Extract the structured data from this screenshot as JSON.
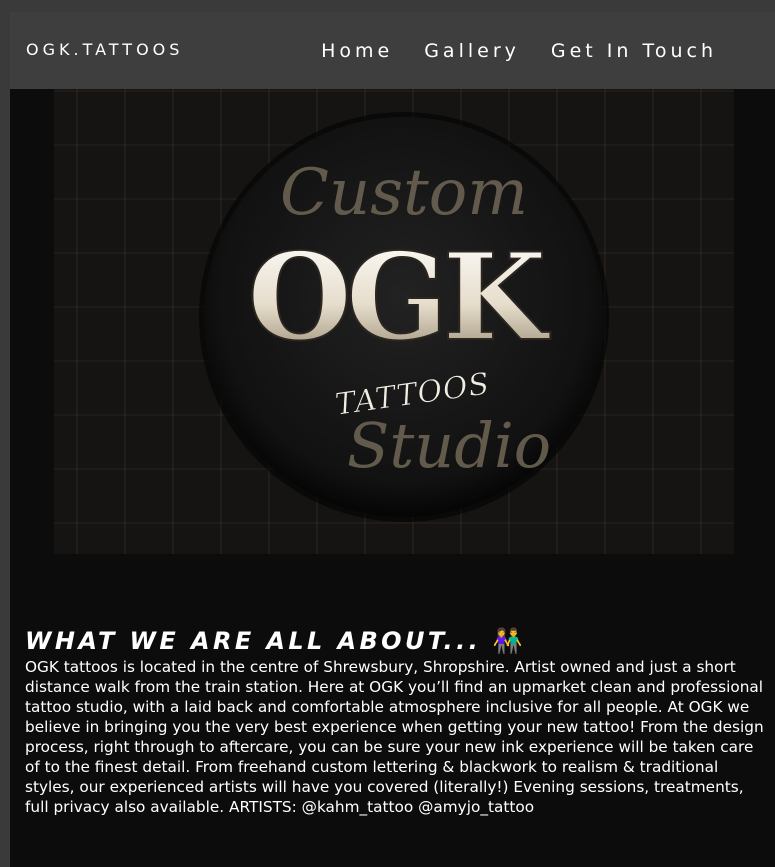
{
  "header": {
    "brand": "OGK.TATTOOS",
    "nav": [
      {
        "label": "Home"
      },
      {
        "label": "Gallery"
      },
      {
        "label": "Get In Touch"
      }
    ],
    "background": "#3e3e3e"
  },
  "hero": {
    "logo": {
      "monogram": "OGK",
      "script_top": "Custom",
      "script_middle": "TATTOOS",
      "script_bottom": "Studio"
    },
    "background": "#161412"
  },
  "about": {
    "title": "WHAT WE ARE ALL ABOUT...",
    "title_emoji": "👫",
    "body": "OGK tattoos is located in the centre of Shrewsbury, Shropshire. Artist owned and just a short distance walk from the train station. Here at OGK you’ll find an upmarket clean and professional tattoo studio, with a laid back and comfortable atmosphere inclusive for all people. At OGK we believe in bringing you the very best experience when getting your new tattoo! From the design process, right through to aftercare, you can be sure your new ink experience will be taken care of to the finest detail. From freehand custom lettering & blackwork to realism & traditional styles, our experienced artists will have you covered (literally!) Evening sessions, treatments, full privacy also available. ARTISTS: @kahm_tattoo @amyjo_tattoo"
  },
  "colors": {
    "page_background": "#0d0c0c",
    "text": "#ffffff",
    "logo_light": "#f2ede2",
    "logo_dark": "#6b6252"
  }
}
